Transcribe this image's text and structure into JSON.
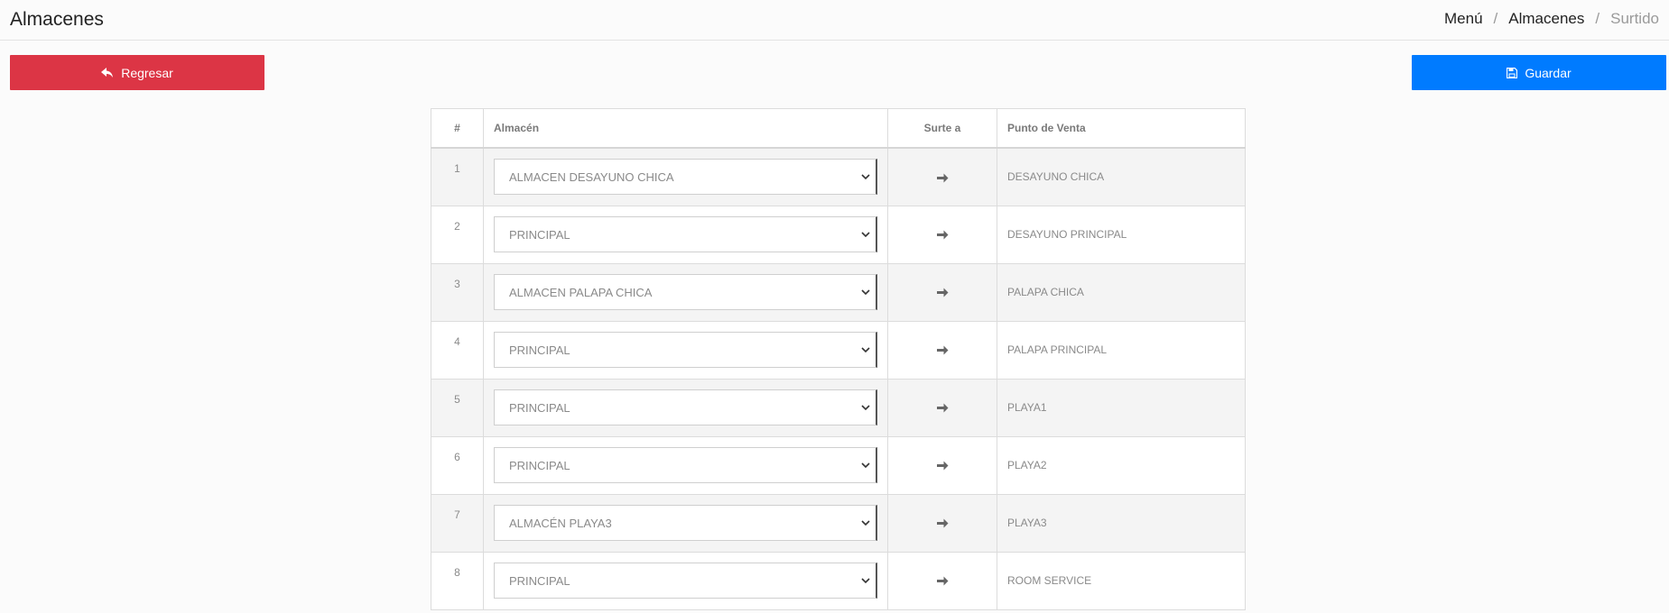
{
  "header": {
    "title": "Almacenes",
    "breadcrumb": [
      {
        "label": "Menú"
      },
      {
        "label": "Almacenes"
      },
      {
        "label": "Surtido"
      }
    ],
    "separator": "/"
  },
  "toolbar": {
    "back_label": "Regresar",
    "back_icon": "reply-arrow-icon",
    "back_color": "#dc3545",
    "save_label": "Guardar",
    "save_icon": "floppy-disk-icon",
    "save_color": "#007bff"
  },
  "table": {
    "columns": {
      "num": "#",
      "almacen": "Almacén",
      "surte": "Surte a",
      "pv": "Punto de Venta"
    },
    "rows": [
      {
        "num": "1",
        "almacen": "ALMACEN DESAYUNO CHICA",
        "pv": "DESAYUNO CHICA"
      },
      {
        "num": "2",
        "almacen": "PRINCIPAL",
        "pv": "DESAYUNO PRINCIPAL"
      },
      {
        "num": "3",
        "almacen": "ALMACEN PALAPA CHICA",
        "pv": "PALAPA CHICA"
      },
      {
        "num": "4",
        "almacen": "PRINCIPAL",
        "pv": "PALAPA PRINCIPAL"
      },
      {
        "num": "5",
        "almacen": "PRINCIPAL",
        "pv": "PLAYA1"
      },
      {
        "num": "6",
        "almacen": "PRINCIPAL",
        "pv": "PLAYA2"
      },
      {
        "num": "7",
        "almacen": "ALMACÉN PLAYA3",
        "pv": "PLAYA3"
      },
      {
        "num": "8",
        "almacen": "PRINCIPAL",
        "pv": "ROOM SERVICE"
      }
    ]
  }
}
